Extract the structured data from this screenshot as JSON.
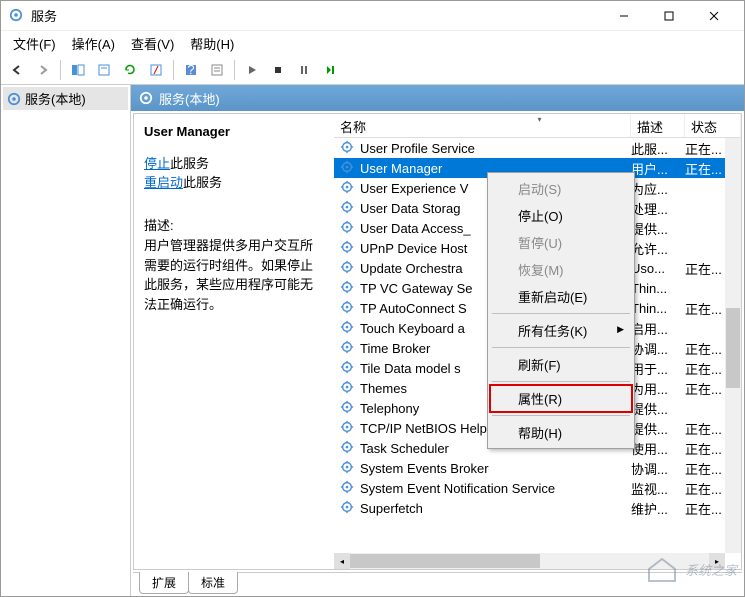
{
  "window": {
    "title": "服务"
  },
  "menubar": [
    "文件(F)",
    "操作(A)",
    "查看(V)",
    "帮助(H)"
  ],
  "leftpane": {
    "node": "服务(本地)"
  },
  "header_strip": "服务(本地)",
  "detail": {
    "service_name": "User Manager",
    "stop_link": "停止",
    "stop_suffix": "此服务",
    "restart_link": "重启动",
    "restart_suffix": "此服务",
    "desc_label": "描述:",
    "desc_text": "用户管理器提供多用户交互所需要的运行时组件。如果停止此服务，某些应用程序可能无法正确运行。"
  },
  "columns": {
    "name": "名称",
    "desc": "描述",
    "status": "状态"
  },
  "rows": [
    {
      "name": "User Profile Service",
      "desc": "此服...",
      "status": "正在...",
      "sel": false
    },
    {
      "name": "User Manager",
      "desc": "用户...",
      "status": "正在...",
      "sel": true
    },
    {
      "name": "User Experience V",
      "desc": "为应...",
      "status": "",
      "sel": false
    },
    {
      "name": "User Data Storag",
      "desc": "处理...",
      "status": "",
      "sel": false
    },
    {
      "name": "User Data Access_",
      "desc": "提供...",
      "status": "",
      "sel": false
    },
    {
      "name": "UPnP Device Host",
      "desc": "允许...",
      "status": "",
      "sel": false
    },
    {
      "name": "Update Orchestra",
      "desc": "Uso...",
      "status": "正在...",
      "sel": false
    },
    {
      "name": "TP VC Gateway Se",
      "desc": "Thin...",
      "status": "",
      "sel": false
    },
    {
      "name": "TP AutoConnect S",
      "desc": "Thin...",
      "status": "正在...",
      "sel": false
    },
    {
      "name": "Touch Keyboard a",
      "desc": "启用...",
      "status": "",
      "sel": false
    },
    {
      "name": "Time Broker",
      "desc": "协调...",
      "status": "正在...",
      "sel": false
    },
    {
      "name": "Tile Data model s",
      "desc": "用于...",
      "status": "正在...",
      "sel": false
    },
    {
      "name": "Themes",
      "desc": "为用...",
      "status": "正在...",
      "sel": false
    },
    {
      "name": "Telephony",
      "desc": "提供...",
      "status": "",
      "sel": false
    },
    {
      "name": "TCP/IP NetBIOS Helper",
      "desc": "提供...",
      "status": "正在...",
      "sel": false
    },
    {
      "name": "Task Scheduler",
      "desc": "使用...",
      "status": "正在...",
      "sel": false
    },
    {
      "name": "System Events Broker",
      "desc": "协调...",
      "status": "正在...",
      "sel": false
    },
    {
      "name": "System Event Notification Service",
      "desc": "监视...",
      "status": "正在...",
      "sel": false
    },
    {
      "name": "Superfetch",
      "desc": "维护...",
      "status": "正在...",
      "sel": false
    }
  ],
  "context_menu": [
    {
      "label": "启动(S)",
      "type": "item",
      "enabled": false
    },
    {
      "label": "停止(O)",
      "type": "item",
      "enabled": true
    },
    {
      "label": "暂停(U)",
      "type": "item",
      "enabled": false
    },
    {
      "label": "恢复(M)",
      "type": "item",
      "enabled": false
    },
    {
      "label": "重新启动(E)",
      "type": "item",
      "enabled": true
    },
    {
      "type": "sep"
    },
    {
      "label": "所有任务(K)",
      "type": "item",
      "enabled": true,
      "arrow": true
    },
    {
      "type": "sep"
    },
    {
      "label": "刷新(F)",
      "type": "item",
      "enabled": true
    },
    {
      "type": "sep"
    },
    {
      "label": "属性(R)",
      "type": "item",
      "enabled": true,
      "highlight": true
    },
    {
      "type": "sep"
    },
    {
      "label": "帮助(H)",
      "type": "item",
      "enabled": true
    }
  ],
  "tabs": {
    "extended": "扩展",
    "standard": "标准"
  },
  "watermark": "系统之家"
}
